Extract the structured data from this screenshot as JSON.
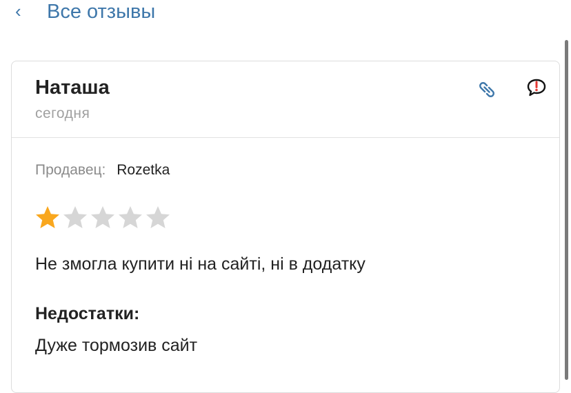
{
  "nav": {
    "back_icon": "chevron-left-icon",
    "title": "Все отзывы"
  },
  "review": {
    "author": "Наташа",
    "date": "сегодня",
    "actions": {
      "link_icon": "link-icon",
      "report_icon": "report-comment-icon"
    },
    "seller_label": "Продавец:",
    "seller_name": "Rozetka",
    "rating": 1,
    "max_rating": 5,
    "text": "Не змогла купити ні на сайті, ні в додатку",
    "cons_title": "Недостатки:",
    "cons_text": "Дуже тормозив сайт"
  },
  "colors": {
    "accent": "#3e77aa",
    "star_filled": "#f9a71e",
    "star_empty": "#d6d6d6",
    "report_exclaim": "#e53935"
  }
}
